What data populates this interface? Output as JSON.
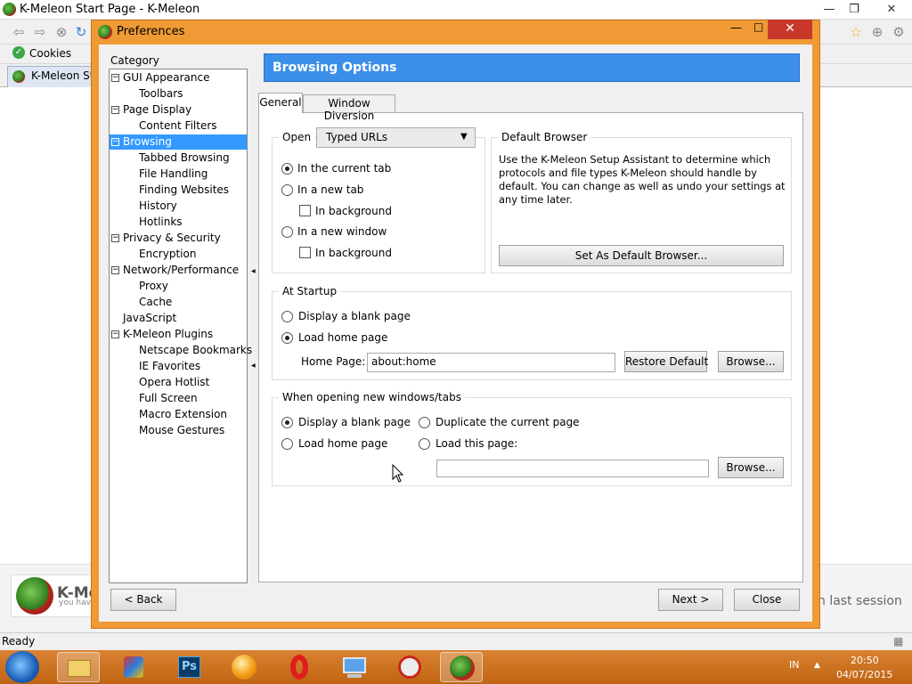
{
  "browser": {
    "window_title": "K-Meleon Start Page - K-Meleon",
    "bookmark_label": "Cookies",
    "tab_label": "K-Meleon Start Page",
    "status_text": "Ready",
    "logo_text": "K-Me",
    "logo_tagline": "you hav",
    "last_session_text": "n last session"
  },
  "taskbar": {
    "lang": "IN",
    "time": "20:50",
    "date": "04/07/2015"
  },
  "dialog": {
    "title": "Preferences",
    "category_label": "Category",
    "header": "Browsing Options",
    "tabs": [
      "General",
      "Window Diversion"
    ],
    "buttons": {
      "back": "< Back",
      "next": "Next >",
      "close": "Close"
    }
  },
  "tree": [
    {
      "label": "GUI Appearance",
      "level": 0,
      "expander": "⊟"
    },
    {
      "label": "Toolbars",
      "level": 1
    },
    {
      "label": "Page Display",
      "level": 0,
      "expander": "⊟"
    },
    {
      "label": "Content Filters",
      "level": 1
    },
    {
      "label": "Browsing",
      "level": 0,
      "expander": "⊟",
      "selected": true
    },
    {
      "label": "Tabbed Browsing",
      "level": 1
    },
    {
      "label": "File Handling",
      "level": 1
    },
    {
      "label": "Finding Websites",
      "level": 1
    },
    {
      "label": "History",
      "level": 1
    },
    {
      "label": "Hotlinks",
      "level": 1
    },
    {
      "label": "Privacy & Security",
      "level": 0,
      "expander": "⊟"
    },
    {
      "label": "Encryption",
      "level": 1
    },
    {
      "label": "Network/Performance",
      "level": 0,
      "expander": "⊟"
    },
    {
      "label": "Proxy",
      "level": 1
    },
    {
      "label": "Cache",
      "level": 1
    },
    {
      "label": "JavaScript",
      "level": 0
    },
    {
      "label": "K-Meleon Plugins",
      "level": 0,
      "expander": "⊟"
    },
    {
      "label": "Netscape Bookmarks",
      "level": 1
    },
    {
      "label": "IE Favorites",
      "level": 1
    },
    {
      "label": "Opera Hotlist",
      "level": 1
    },
    {
      "label": "Full Screen",
      "level": 1
    },
    {
      "label": "Macro Extension",
      "level": 1
    },
    {
      "label": "Mouse Gestures",
      "level": 1
    }
  ],
  "open_group": {
    "open_label": "Open",
    "open_value": "Typed URLs",
    "current_tab": "In the current tab",
    "new_tab": "In a new tab",
    "background1": "In background",
    "new_window": "In a new window",
    "background2": "In background",
    "selected": "current_tab"
  },
  "default_browser": {
    "legend": "Default Browser",
    "description": "Use the K-Meleon Setup Assistant to determine which protocols and file types K-Meleon should handle by default. You can change as well as undo your settings at any time later.",
    "button": "Set As Default Browser..."
  },
  "startup": {
    "legend": "At Startup",
    "blank": "Display a blank page",
    "home": "Load home page",
    "selected": "home",
    "home_page_label": "Home Page:",
    "home_page_value": "about:home",
    "restore": "Restore Default",
    "browse": "Browse..."
  },
  "new_windows": {
    "legend": "When opening new windows/tabs",
    "blank": "Display a blank page",
    "home": "Load home page",
    "duplicate": "Duplicate the current page",
    "load_this": "Load this page:",
    "selected": "blank",
    "page_value": "",
    "browse": "Browse..."
  },
  "colors": {
    "dialog_frame": "#ef9a35",
    "header_blue": "#3b8fe8",
    "selection": "#3399ff",
    "taskbar": "#c8701e",
    "close_red": "#c7382a"
  }
}
